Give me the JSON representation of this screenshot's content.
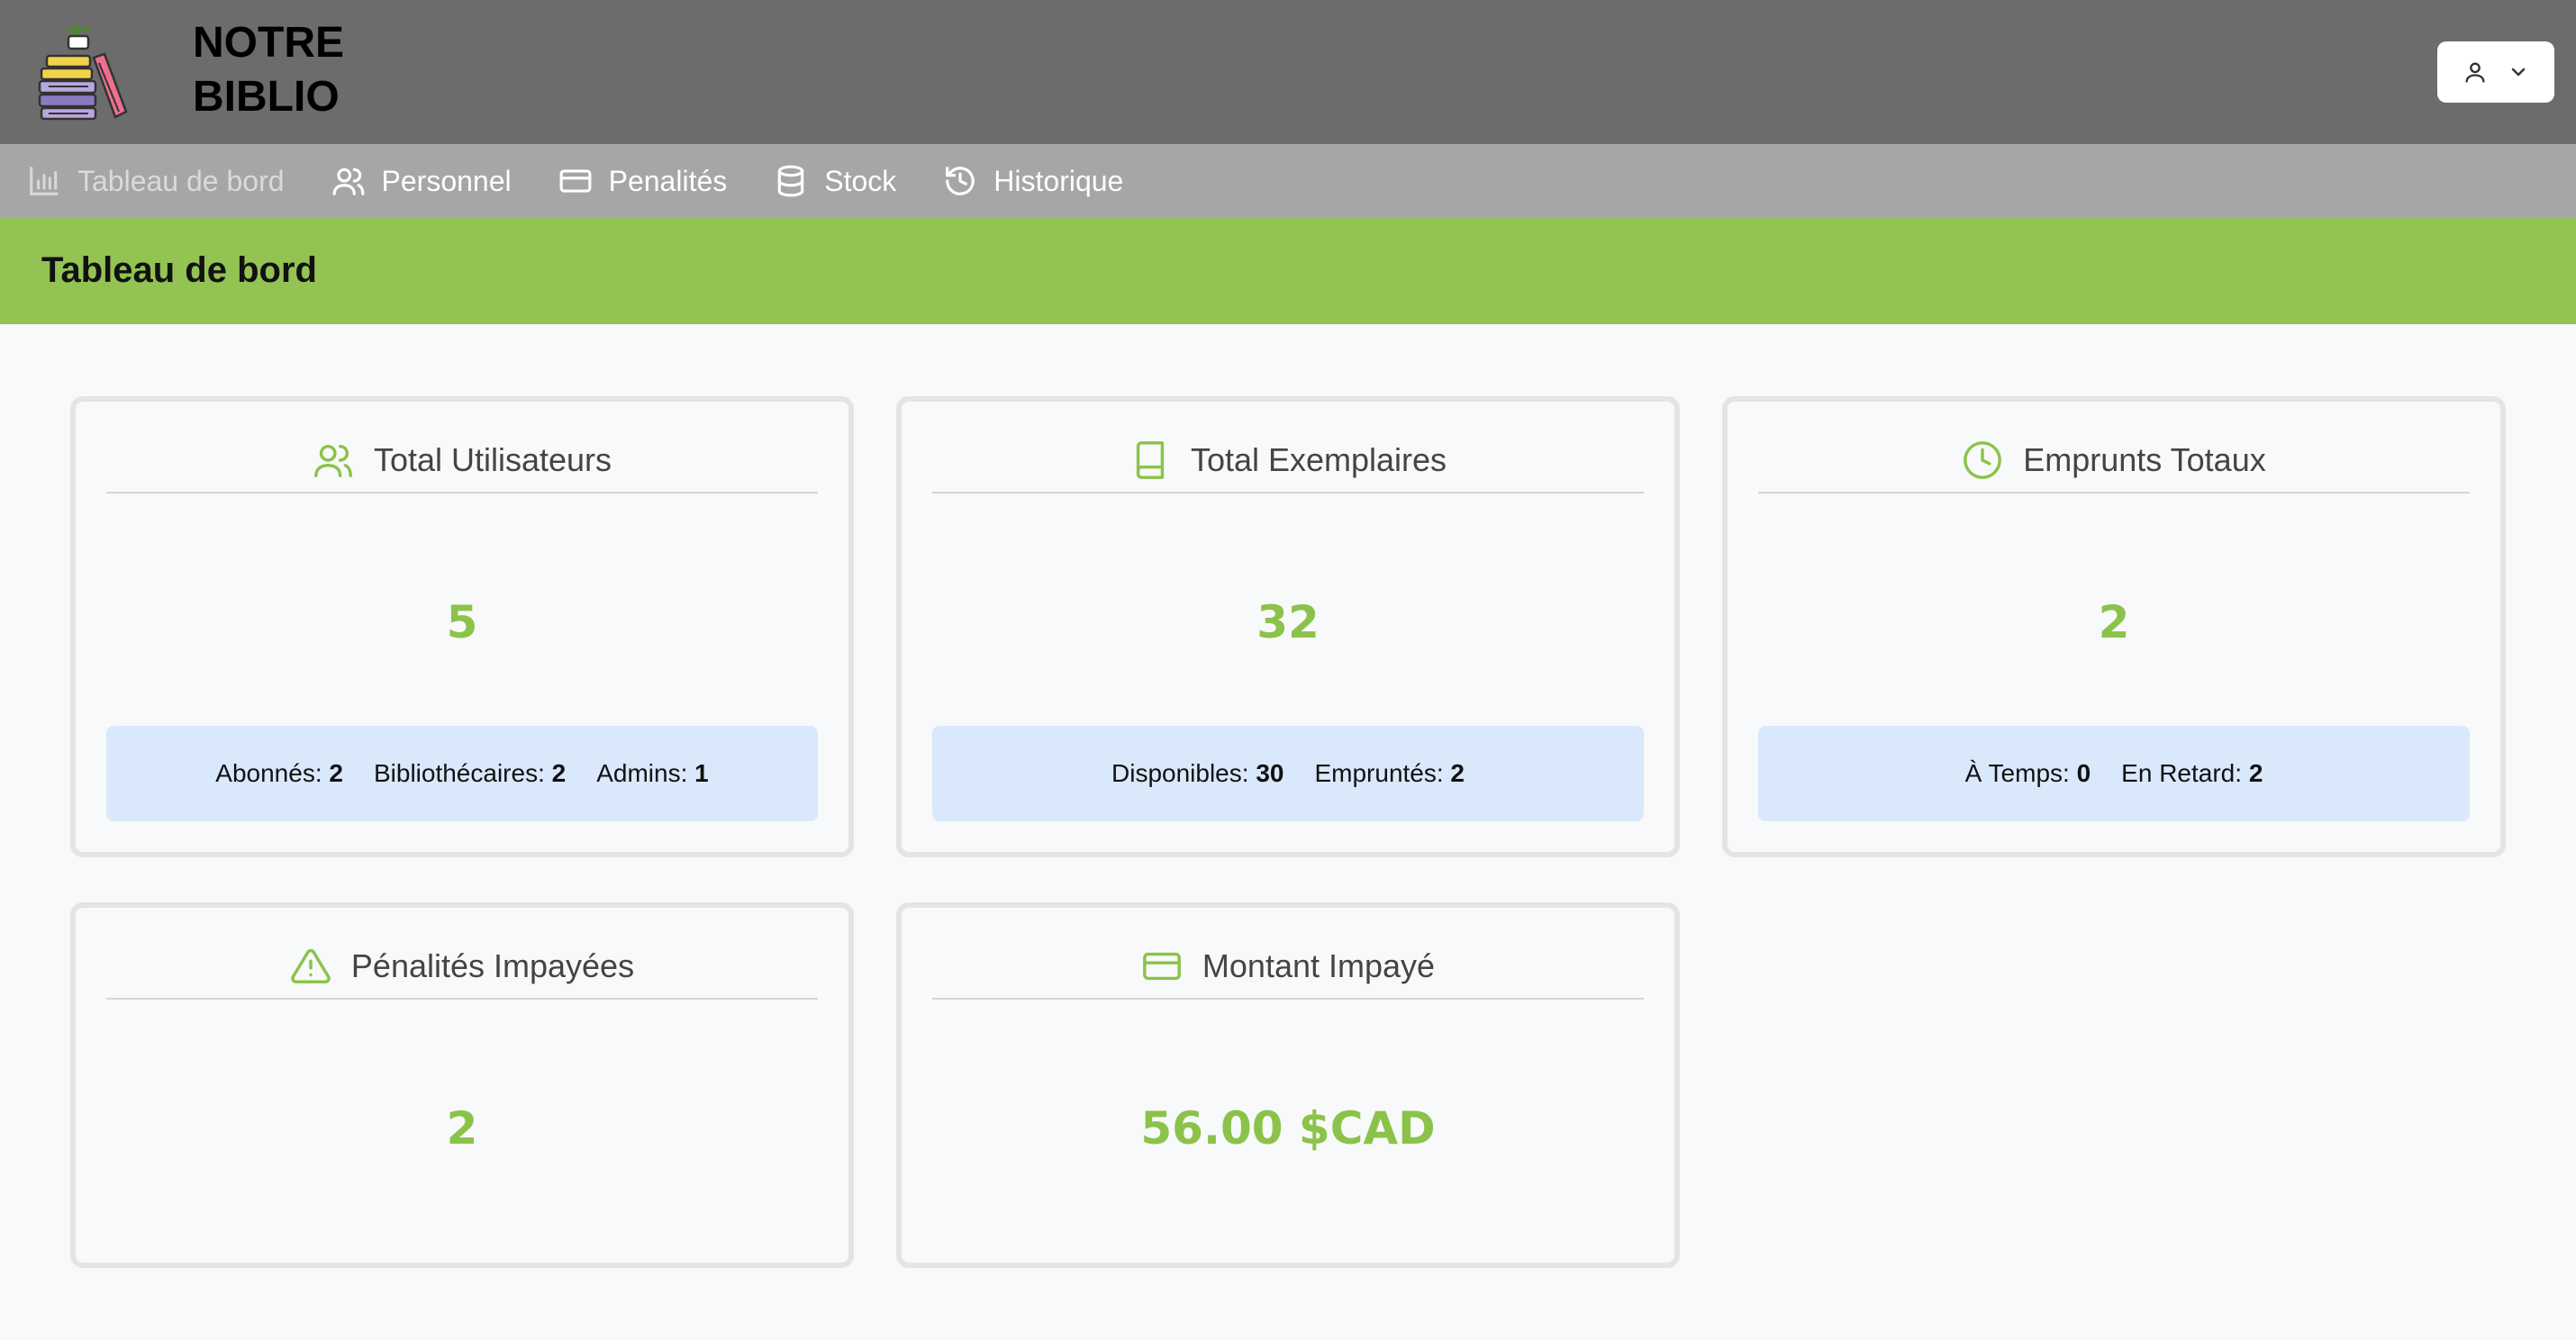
{
  "header": {
    "brand_line1": "NOTRE",
    "brand_line2": "BIBLIO",
    "logo_icon": "books-stack-logo",
    "user_icon": "user-icon",
    "user_menu_icon": "chevron-down-icon"
  },
  "nav": {
    "items": [
      {
        "label": "Tableau de bord",
        "icon": "bar-chart-icon",
        "active": true
      },
      {
        "label": "Personnel",
        "icon": "users-icon"
      },
      {
        "label": "Penalités",
        "icon": "credit-card-icon"
      },
      {
        "label": "Stock",
        "icon": "database-icon"
      },
      {
        "label": "Historique",
        "icon": "history-icon"
      }
    ]
  },
  "page": {
    "title": "Tableau de bord"
  },
  "colors": {
    "accent": "#8bc34a",
    "titlebar": "#93c353",
    "header": "#6c6c6c",
    "nav": "#a6a6a6",
    "info_bg": "#d9e8fb"
  },
  "cards": {
    "users": {
      "title": "Total Utilisateurs",
      "icon": "users-icon",
      "value": "5",
      "stats": [
        {
          "label": "Abonnés:",
          "value": "2"
        },
        {
          "label": "Bibliothécaires:",
          "value": "2"
        },
        {
          "label": "Admins:",
          "value": "1"
        }
      ]
    },
    "copies": {
      "title": "Total Exemplaires",
      "icon": "book-icon",
      "value": "32",
      "stats": [
        {
          "label": "Disponibles:",
          "value": "30"
        },
        {
          "label": "Empruntés:",
          "value": "2"
        }
      ]
    },
    "loans": {
      "title": "Emprunts Totaux",
      "icon": "clock-icon",
      "value": "2",
      "stats": [
        {
          "label": "À Temps:",
          "value": "0"
        },
        {
          "label": "En Retard:",
          "value": "2"
        }
      ]
    },
    "penalties": {
      "title": "Pénalités Impayées",
      "icon": "alert-triangle-icon",
      "value": "2"
    },
    "amount": {
      "title": "Montant Impayé",
      "icon": "credit-card-icon",
      "value": "56.00 $CAD"
    }
  }
}
